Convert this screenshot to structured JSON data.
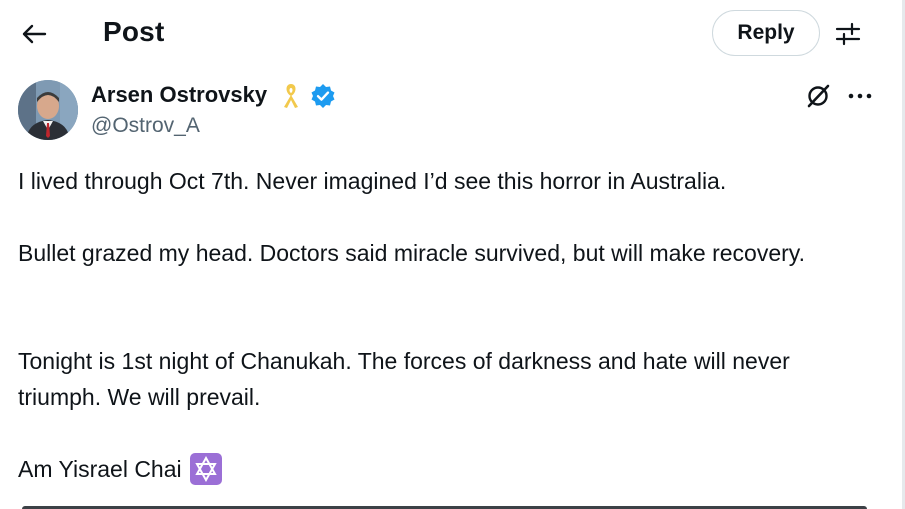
{
  "header": {
    "title": "Post",
    "reply_label": "Reply"
  },
  "author": {
    "name": "Arsen Ostrovsky",
    "handle": "@Ostrov_A"
  },
  "post": {
    "paragraphs": [
      "I lived through Oct 7th. Never imagined I’d see this horror in Australia.",
      "Bullet grazed my head. Doctors said miracle survived, but will make recovery.",
      "Tonight is 1st night of Chanukah. The forces of darkness and hate will never triumph. We will prevail.",
      "Am Yisrael Chai"
    ]
  },
  "icons": {
    "back": "arrow-left-icon",
    "settings": "sliders-icon",
    "ribbon": "yellow-ribbon-icon",
    "verified": "verified-badge-icon",
    "grok": "grok-icon",
    "more": "more-dots-icon",
    "star": "star-of-david-emoji"
  },
  "colors": {
    "text": "#0f1419",
    "secondary": "#536471",
    "verified": "#1d9bf0",
    "ribbon": "#f2c94c",
    "emoji_bg": "#9b6fd6"
  }
}
